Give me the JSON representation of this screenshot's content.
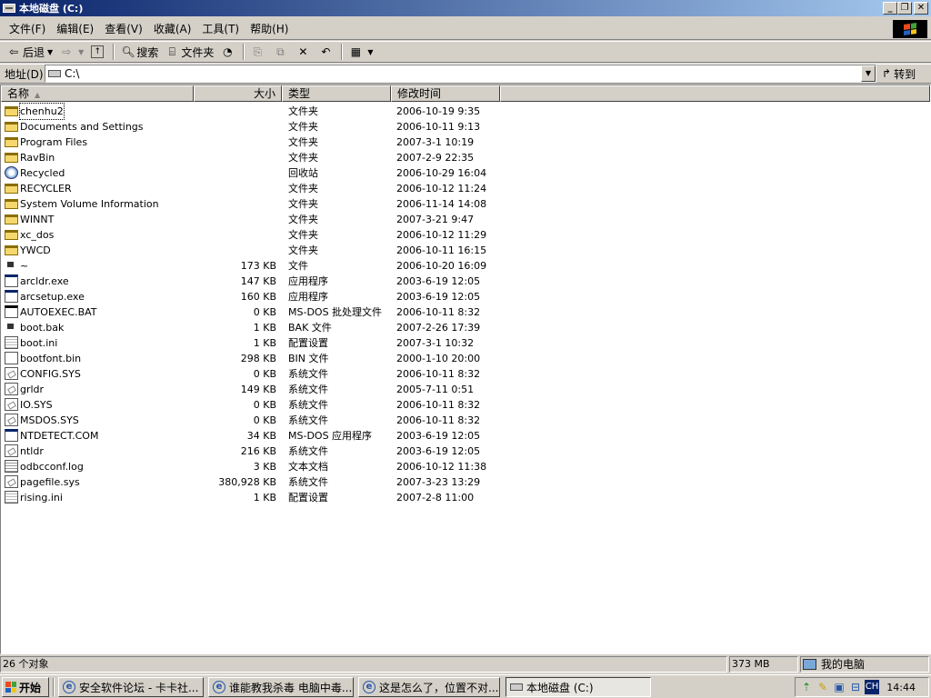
{
  "window": {
    "title": "本地磁盘 (C:)",
    "buttons": [
      "0",
      "1",
      "r"
    ]
  },
  "menu": [
    "文件(F)",
    "编辑(E)",
    "查看(V)",
    "收藏(A)",
    "工具(T)",
    "帮助(H)"
  ],
  "toolbar": {
    "back": "后退",
    "search": "搜索",
    "folders": "文件夹"
  },
  "address": {
    "label": "地址(D)",
    "value": "C:\\",
    "go": "转到"
  },
  "columns": {
    "name": "名称",
    "size": "大小",
    "type": "类型",
    "modified": "修改时间"
  },
  "files": [
    {
      "name": "chenhu2",
      "size": "",
      "type": "文件夹",
      "modified": "2006-10-19 9:35",
      "icon": "folder"
    },
    {
      "name": "Documents and Settings",
      "size": "",
      "type": "文件夹",
      "modified": "2006-10-11 9:13",
      "icon": "folder"
    },
    {
      "name": "Program Files",
      "size": "",
      "type": "文件夹",
      "modified": "2007-3-1 10:19",
      "icon": "folder"
    },
    {
      "name": "RavBin",
      "size": "",
      "type": "文件夹",
      "modified": "2007-2-9 22:35",
      "icon": "folder"
    },
    {
      "name": "Recycled",
      "size": "",
      "type": "回收站",
      "modified": "2006-10-29 16:04",
      "icon": "recycle"
    },
    {
      "name": "RECYCLER",
      "size": "",
      "type": "文件夹",
      "modified": "2006-10-12 11:24",
      "icon": "folder"
    },
    {
      "name": "System Volume Information",
      "size": "",
      "type": "文件夹",
      "modified": "2006-11-14 14:08",
      "icon": "folder"
    },
    {
      "name": "WINNT",
      "size": "",
      "type": "文件夹",
      "modified": "2007-3-21 9:47",
      "icon": "folder"
    },
    {
      "name": "xc_dos",
      "size": "",
      "type": "文件夹",
      "modified": "2006-10-12 11:29",
      "icon": "folder"
    },
    {
      "name": "YWCD",
      "size": "",
      "type": "文件夹",
      "modified": "2006-10-11 16:15",
      "icon": "folder"
    },
    {
      "name": "~",
      "size": "173 KB",
      "type": "文件",
      "modified": "2006-10-20 16:09",
      "icon": "bak"
    },
    {
      "name": "arcldr.exe",
      "size": "147 KB",
      "type": "应用程序",
      "modified": "2003-6-19 12:05",
      "icon": "exe"
    },
    {
      "name": "arcsetup.exe",
      "size": "160 KB",
      "type": "应用程序",
      "modified": "2003-6-19 12:05",
      "icon": "exe"
    },
    {
      "name": "AUTOEXEC.BAT",
      "size": "0 KB",
      "type": "MS-DOS 批处理文件",
      "modified": "2006-10-11 8:32",
      "icon": "bat"
    },
    {
      "name": "boot.bak",
      "size": "1 KB",
      "type": "BAK 文件",
      "modified": "2007-2-26 17:39",
      "icon": "bak"
    },
    {
      "name": "boot.ini",
      "size": "1 KB",
      "type": "配置设置",
      "modified": "2007-3-1 10:32",
      "icon": "ini"
    },
    {
      "name": "bootfont.bin",
      "size": "298 KB",
      "type": "BIN 文件",
      "modified": "2000-1-10 20:00",
      "icon": "file"
    },
    {
      "name": "CONFIG.SYS",
      "size": "0 KB",
      "type": "系统文件",
      "modified": "2006-10-11 8:32",
      "icon": "sys"
    },
    {
      "name": "grldr",
      "size": "149 KB",
      "type": "系统文件",
      "modified": "2005-7-11 0:51",
      "icon": "sys"
    },
    {
      "name": "IO.SYS",
      "size": "0 KB",
      "type": "系统文件",
      "modified": "2006-10-11 8:32",
      "icon": "sys"
    },
    {
      "name": "MSDOS.SYS",
      "size": "0 KB",
      "type": "系统文件",
      "modified": "2006-10-11 8:32",
      "icon": "sys"
    },
    {
      "name": "NTDETECT.COM",
      "size": "34 KB",
      "type": "MS-DOS 应用程序",
      "modified": "2003-6-19 12:05",
      "icon": "exe"
    },
    {
      "name": "ntldr",
      "size": "216 KB",
      "type": "系统文件",
      "modified": "2003-6-19 12:05",
      "icon": "sys"
    },
    {
      "name": "odbcconf.log",
      "size": "3 KB",
      "type": "文本文档",
      "modified": "2006-10-12 11:38",
      "icon": "txt"
    },
    {
      "name": "pagefile.sys",
      "size": "380,928 KB",
      "type": "系统文件",
      "modified": "2007-3-23 13:29",
      "icon": "sys"
    },
    {
      "name": "rising.ini",
      "size": "1 KB",
      "type": "配置设置",
      "modified": "2007-2-8 11:00",
      "icon": "ini"
    }
  ],
  "status": {
    "count": "26 个对象",
    "size": "373 MB",
    "location": "我的电脑"
  },
  "taskbar": {
    "start": "开始",
    "tasks": [
      {
        "label": "安全软件论坛 - 卡卡社...",
        "icon": "ie-icon"
      },
      {
        "label": "谁能教我杀毒 电脑中毒...",
        "icon": "ie-icon"
      },
      {
        "label": "这是怎么了，位置不对...",
        "icon": "ie-icon"
      },
      {
        "label": "本地磁盘 (C:)",
        "icon": "drive-icon",
        "active": true
      }
    ],
    "tray_lang": "CH",
    "clock": "14:44"
  }
}
